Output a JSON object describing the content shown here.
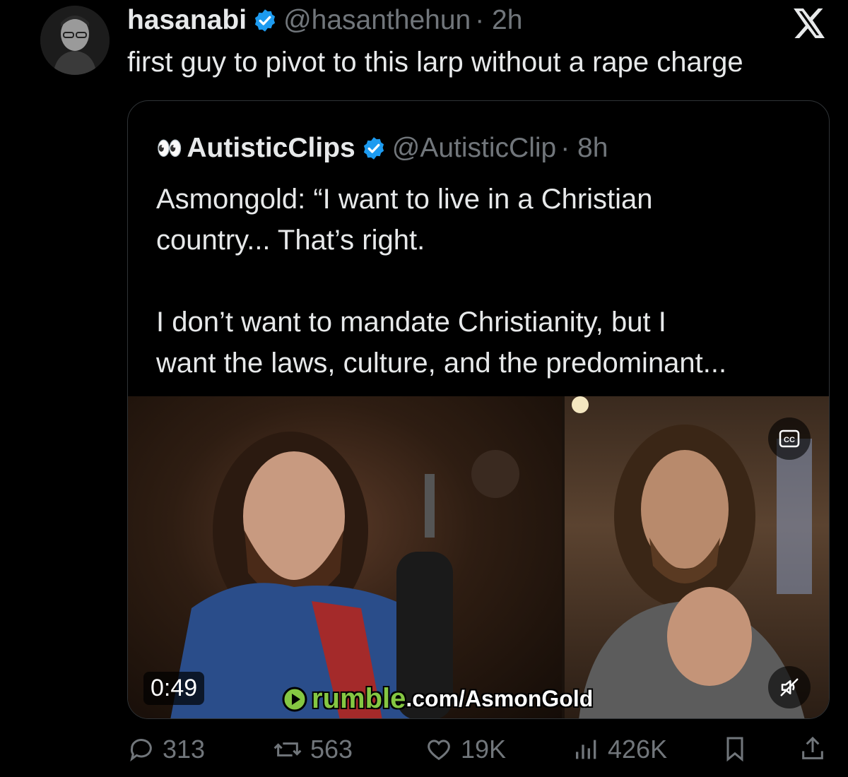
{
  "tweet": {
    "display_name": "hasanabi",
    "handle": "@hasanthehun",
    "time": "· 2h",
    "text": "first guy to pivot to this larp without a rape charge"
  },
  "quote": {
    "eyes_emoji": "👀",
    "display_name": "AutisticClips",
    "handle": "@AutisticClip",
    "time": "· 8h",
    "text": "Asmongold: “I want to live in a Christian\ncountry... That’s right.\n\nI don’t want to mandate Christianity, but I\nwant the laws, culture, and the predominant..."
  },
  "media": {
    "duration": "0:49",
    "watermark_brand": "rumble",
    "watermark_rest": ".com/AsmonGold",
    "cc_label": "CC"
  },
  "actions": {
    "replies": "313",
    "reposts": "563",
    "likes": "19K",
    "views": "426K"
  },
  "colors": {
    "verified": "#1d9bf0",
    "muted_text": "#71767b",
    "rumble_green": "#85c742"
  },
  "icons": [
    "x-logo-icon",
    "verified-badge-icon",
    "cc-icon",
    "mute-icon",
    "reply-icon",
    "repost-icon",
    "like-icon",
    "views-icon",
    "bookmark-icon",
    "share-icon"
  ]
}
